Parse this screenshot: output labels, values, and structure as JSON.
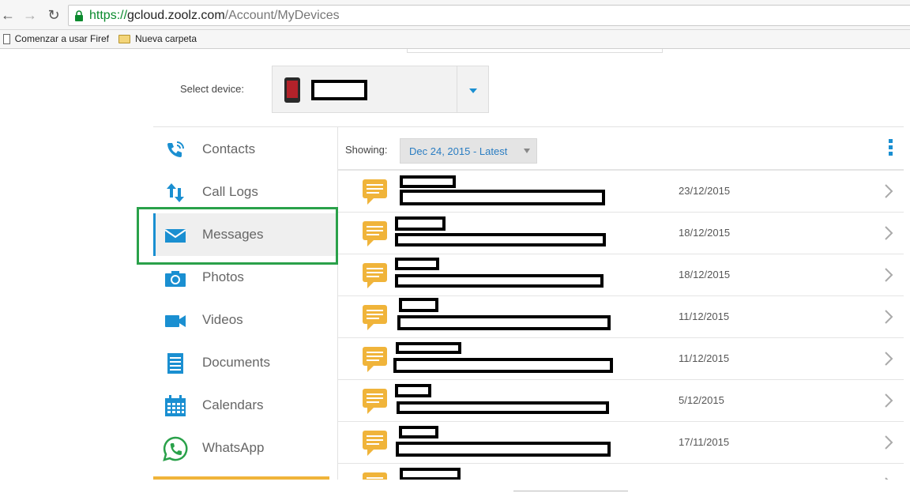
{
  "browser": {
    "url_scheme": "https://",
    "url_host": "gcloud.zoolz.com",
    "url_path": "/Account/MyDevices",
    "icons": {
      "back": "back-arrow-icon",
      "forward": "forward-arrow-icon",
      "reload": "reload-icon",
      "lock": "lock-icon"
    }
  },
  "bookmarks": [
    {
      "label": "Comenzar a usar Firef",
      "icon": "page-icon"
    },
    {
      "label": "Nueva carpeta",
      "icon": "folder-icon"
    }
  ],
  "device_selector": {
    "label": "Select device:",
    "icon": "phone-icon"
  },
  "sidebar": {
    "items": [
      {
        "label": "Contacts",
        "icon": "phone-contacts-icon"
      },
      {
        "label": "Call Logs",
        "icon": "call-logs-arrows-icon"
      },
      {
        "label": "Messages",
        "icon": "envelope-icon",
        "active": true
      },
      {
        "label": "Photos",
        "icon": "camera-icon"
      },
      {
        "label": "Videos",
        "icon": "video-camera-icon"
      },
      {
        "label": "Documents",
        "icon": "document-icon"
      },
      {
        "label": "Calendars",
        "icon": "calendar-icon"
      },
      {
        "label": "WhatsApp",
        "icon": "whatsapp-icon"
      }
    ]
  },
  "toolbar": {
    "showing_label": "Showing:",
    "date_range": "Dec 24, 2015 - Latest",
    "menu_icon": "kebab-menu-icon"
  },
  "messages": {
    "rows": [
      {
        "date": "23/12/2015"
      },
      {
        "date": "18/12/2015"
      },
      {
        "date": "18/12/2015"
      },
      {
        "date": "11/12/2015"
      },
      {
        "date": "11/12/2015"
      },
      {
        "date": "5/12/2015"
      },
      {
        "date": "17/11/2015"
      },
      {
        "date": ""
      }
    ],
    "row_icon": "chat-bubble-icon",
    "row_chevron": "chevron-right-icon"
  },
  "colors": {
    "accent": "#1a8fd1",
    "message_icon": "#f0b43a",
    "highlight": "#2aa14a",
    "url_secure": "#0b8a2e"
  }
}
